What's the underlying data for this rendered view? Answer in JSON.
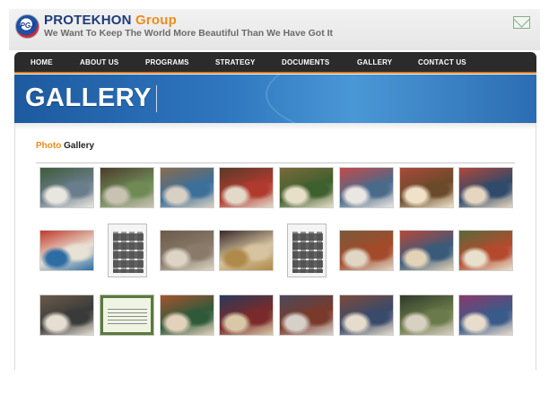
{
  "brand": {
    "name": "PROTEKHON",
    "name_accent": "Group",
    "tagline": "We Want To Keep The World More Beautiful Than We Have Got It",
    "logo_text": "PGJ"
  },
  "icons": {
    "mail": "mail-icon",
    "logo": "logo-icon"
  },
  "nav": {
    "items": [
      {
        "label": "HOME"
      },
      {
        "label": "ABOUT US"
      },
      {
        "label": "PROGRAMS"
      },
      {
        "label": "STRATEGY"
      },
      {
        "label": "DOCUMENTS"
      },
      {
        "label": "GALLERY"
      },
      {
        "label": "CONTACT US"
      }
    ]
  },
  "banner": {
    "title": "GALLERY"
  },
  "gallery": {
    "title_accent": "Photo",
    "title": "Gallery",
    "rows": [
      [
        {
          "kind": "photo",
          "palette": [
            "#3f5b3a",
            "#e9e6df",
            "#6a7d8c"
          ]
        },
        {
          "kind": "photo",
          "palette": [
            "#4b3b2e",
            "#c9c2b3",
            "#6f8a55"
          ]
        },
        {
          "kind": "photo",
          "palette": [
            "#8a6b4e",
            "#d8d0c2",
            "#3c6f9a"
          ]
        },
        {
          "kind": "photo",
          "palette": [
            "#5a3a2a",
            "#e3d9c9",
            "#b03a2e"
          ]
        },
        {
          "kind": "photo",
          "palette": [
            "#7a6a3a",
            "#e8dfc8",
            "#3e5f2e"
          ]
        },
        {
          "kind": "photo",
          "palette": [
            "#c44a4a",
            "#eae6e2",
            "#4a6a8a"
          ]
        },
        {
          "kind": "photo",
          "palette": [
            "#a84a3a",
            "#f0e2c8",
            "#6a4a2a"
          ]
        },
        {
          "kind": "photo",
          "palette": [
            "#b0473a",
            "#e6d6c0",
            "#2f4a6a"
          ]
        }
      ],
      [
        {
          "kind": "photo",
          "palette": [
            "#c0392b",
            "#2e6da4",
            "#e8e2d4"
          ]
        },
        {
          "kind": "doc",
          "palette": [
            "#f4f4f4",
            "#7a7a7a",
            "#2a2a2a"
          ]
        },
        {
          "kind": "photo",
          "palette": [
            "#6a5a4a",
            "#dcd4c4",
            "#8a7a6a"
          ]
        },
        {
          "kind": "photo",
          "palette": [
            "#3a2a2a",
            "#b08a4a",
            "#d6c4a0"
          ]
        },
        {
          "kind": "doc",
          "palette": [
            "#f4f4f4",
            "#6a6a6a",
            "#2a2a2a"
          ]
        },
        {
          "kind": "photo",
          "palette": [
            "#7a5a3a",
            "#e0d6c4",
            "#a34a2a"
          ]
        },
        {
          "kind": "photo",
          "palette": [
            "#b8473a",
            "#e2d2b8",
            "#3a5a7a"
          ]
        },
        {
          "kind": "photo",
          "palette": [
            "#5a6a3a",
            "#e8e0cc",
            "#b34a2e"
          ]
        }
      ],
      [
        {
          "kind": "photo",
          "palette": [
            "#6a5a4a",
            "#e6ded0",
            "#3a3a3a"
          ]
        },
        {
          "kind": "doc",
          "palette": [
            "#eef3e4",
            "#5a7a3a",
            "#2a2a2a"
          ]
        },
        {
          "kind": "photo",
          "palette": [
            "#a8532e",
            "#e2d2bc",
            "#2f5a3a"
          ]
        },
        {
          "kind": "photo",
          "palette": [
            "#2a3a5a",
            "#d8c8a8",
            "#7a2a2a"
          ]
        },
        {
          "kind": "photo",
          "palette": [
            "#4a4a5a",
            "#d6d0c8",
            "#7a3a2a"
          ]
        },
        {
          "kind": "photo",
          "palette": [
            "#7a4a3a",
            "#e6dccc",
            "#3a4a6a"
          ]
        },
        {
          "kind": "photo",
          "palette": [
            "#2f3a2a",
            "#d8d0c0",
            "#6a7a4a"
          ]
        },
        {
          "kind": "photo",
          "palette": [
            "#8a3a6a",
            "#e8dccc",
            "#3a5a8a"
          ]
        }
      ]
    ]
  }
}
